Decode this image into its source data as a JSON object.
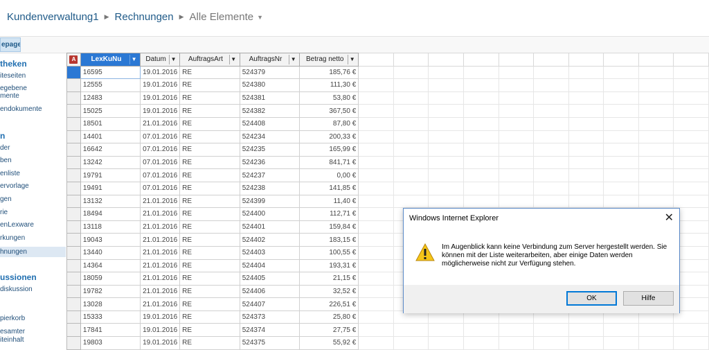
{
  "breadcrumb": {
    "site": "Kundenverwaltung1",
    "list": "Rechnungen",
    "view": "Alle Elemente"
  },
  "ribbon": {
    "tab_label": "epage"
  },
  "leftnav": [
    {
      "label": "theken",
      "type": "head"
    },
    {
      "label": "iteseiten",
      "type": "sub"
    },
    {
      "label": "egebene",
      "type": "sub"
    },
    {
      "label": "mente",
      "type": "sub"
    },
    {
      "label": "endokumente",
      "type": "sub"
    },
    {
      "label": "n",
      "type": "head"
    },
    {
      "label": "der",
      "type": "sub"
    },
    {
      "label": "ben",
      "type": "sub"
    },
    {
      "label": "enliste",
      "type": "sub"
    },
    {
      "label": "ervorlage",
      "type": "sub"
    },
    {
      "label": "gen",
      "type": "sub"
    },
    {
      "label": "rie",
      "type": "sub"
    },
    {
      "label": "enLexware",
      "type": "sub"
    },
    {
      "label": "rkungen",
      "type": "sub"
    },
    {
      "label": "hnungen",
      "type": "sub",
      "selected": true
    },
    {
      "label": "ussionen",
      "type": "head"
    },
    {
      "label": "diskussion",
      "type": "sub"
    },
    {
      "label": "pierkorb",
      "type": "sub"
    },
    {
      "label": "esamter",
      "type": "sub"
    },
    {
      "label": "iteinhalt",
      "type": "sub"
    }
  ],
  "table": {
    "columns": [
      "LexKuNu",
      "Datum",
      "AuftragsArt",
      "AuftragsNr",
      "Betrag netto"
    ],
    "rows": [
      [
        "16595",
        "19.01.2016",
        "RE",
        "524379",
        "185,76 €"
      ],
      [
        "12555",
        "19.01.2016",
        "RE",
        "524380",
        "111,30 €"
      ],
      [
        "12483",
        "19.01.2016",
        "RE",
        "524381",
        "53,80 €"
      ],
      [
        "15025",
        "19.01.2016",
        "RE",
        "524382",
        "367,50 €"
      ],
      [
        "18501",
        "21.01.2016",
        "RE",
        "524408",
        "87,80 €"
      ],
      [
        "14401",
        "07.01.2016",
        "RE",
        "524234",
        "200,33 €"
      ],
      [
        "16642",
        "07.01.2016",
        "RE",
        "524235",
        "165,99 €"
      ],
      [
        "13242",
        "07.01.2016",
        "RE",
        "524236",
        "841,71 €"
      ],
      [
        "19791",
        "07.01.2016",
        "RE",
        "524237",
        "0,00 €"
      ],
      [
        "19491",
        "07.01.2016",
        "RE",
        "524238",
        "141,85 €"
      ],
      [
        "13132",
        "21.01.2016",
        "RE",
        "524399",
        "11,40 €"
      ],
      [
        "18494",
        "21.01.2016",
        "RE",
        "524400",
        "112,71 €"
      ],
      [
        "13118",
        "21.01.2016",
        "RE",
        "524401",
        "159,84 €"
      ],
      [
        "19043",
        "21.01.2016",
        "RE",
        "524402",
        "183,15 €"
      ],
      [
        "13440",
        "21.01.2016",
        "RE",
        "524403",
        "100,55 €"
      ],
      [
        "14364",
        "21.01.2016",
        "RE",
        "524404",
        "193,31 €"
      ],
      [
        "18059",
        "21.01.2016",
        "RE",
        "524405",
        "21,15 €"
      ],
      [
        "19782",
        "21.01.2016",
        "RE",
        "524406",
        "32,52 €"
      ],
      [
        "13028",
        "21.01.2016",
        "RE",
        "524407",
        "226,51 €"
      ],
      [
        "15333",
        "19.01.2016",
        "RE",
        "524373",
        "25,80 €"
      ],
      [
        "17841",
        "19.01.2016",
        "RE",
        "524374",
        "27,75 €"
      ],
      [
        "19803",
        "19.01.2016",
        "RE",
        "524375",
        "55,92 €"
      ]
    ]
  },
  "dialog": {
    "title": "Windows Internet Explorer",
    "message": "Im Augenblick kann keine Verbindung zum Server hergestellt werden. Sie können mit der Liste weiterarbeiten, aber einige Daten werden möglicherweise nicht zur Verfügung stehen.",
    "ok_label": "OK",
    "help_label": "Hilfe"
  },
  "colors": {
    "accent": "#2b78d4",
    "link": "#1f5a88",
    "nav_head": "#1f6eb0",
    "access_icon": "#b8362f",
    "warning": "#f5c518"
  },
  "icons": {
    "access": "access-icon",
    "warning": "warning-icon",
    "close": "close-icon",
    "dropdown": "chevron-down-icon"
  }
}
